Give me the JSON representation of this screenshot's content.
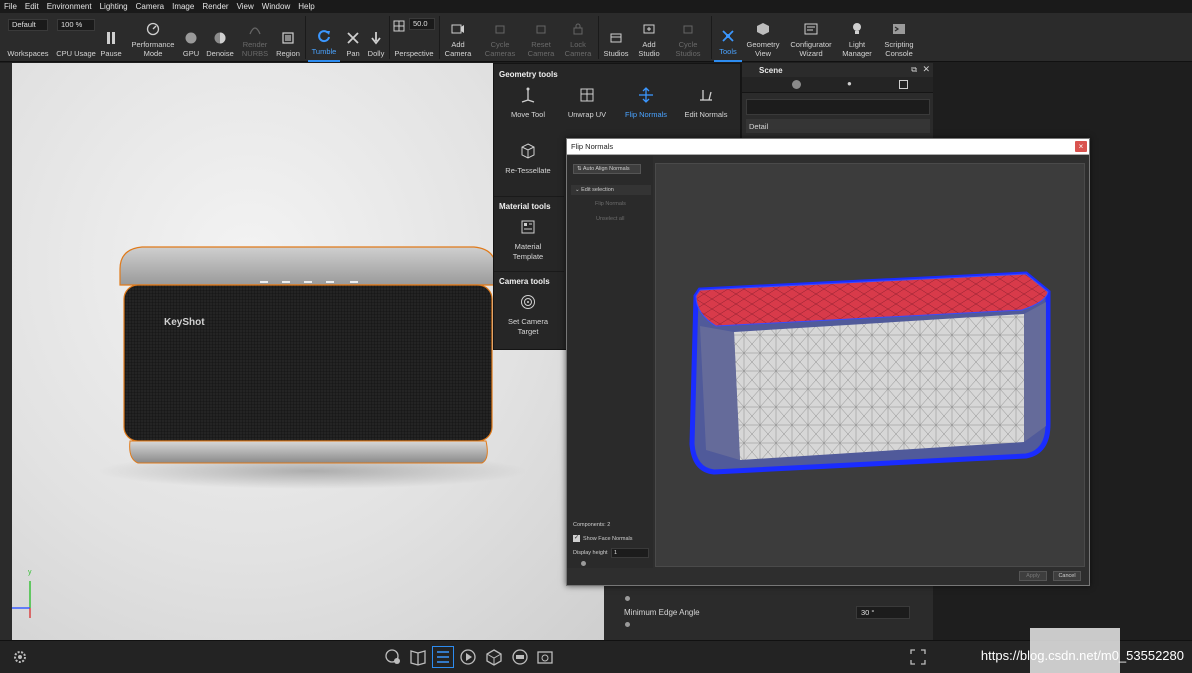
{
  "menu": [
    "File",
    "Edit",
    "Environment",
    "Lighting",
    "Camera",
    "Image",
    "Render",
    "View",
    "Window",
    "Help"
  ],
  "toolbar": {
    "workspace_value": "Default",
    "workspaces_label": "Workspaces",
    "cpu_value": "100 %",
    "cpu_label": "CPU Usage",
    "pause_label": "Pause",
    "performance_label_1": "Performance",
    "performance_label_2": "Mode",
    "gpu_label": "GPU",
    "denoise_label": "Denoise",
    "render_nurbs_1": "Render",
    "render_nurbs_2": "NURBS",
    "region_label": "Region",
    "tumble_label": "Tumble",
    "pan_label": "Pan",
    "dolly_label": "Dolly",
    "fov_value": "50.0",
    "perspective_label": "Perspective",
    "add_camera_1": "Add",
    "add_camera_2": "Camera",
    "cycle_cameras_1": "Cycle",
    "cycle_cameras_2": "Cameras",
    "reset_camera_1": "Reset",
    "reset_camera_2": "Camera",
    "lock_camera_1": "Lock",
    "lock_camera_2": "Camera",
    "studios_label": "Studios",
    "add_studio_1": "Add",
    "add_studio_2": "Studio",
    "cycle_studios_1": "Cycle",
    "cycle_studios_2": "Studios",
    "tools_label": "Tools",
    "geometry_view_1": "Geometry",
    "geometry_view_2": "View",
    "configurator_1": "Configurator",
    "configurator_2": "Wizard",
    "light_manager_1": "Light",
    "light_manager_2": "Manager",
    "scripting_1": "Scripting",
    "scripting_2": "Console"
  },
  "tools_panel": {
    "geometry_heading": "Geometry tools",
    "move_tool": "Move Tool",
    "unwrap_uv": "Unwrap UV",
    "flip_normals": "Flip Normals",
    "edit_normals": "Edit Normals",
    "retessellate": "Re-Tessellate",
    "material_heading": "Material tools",
    "material_template_1": "Material",
    "material_template_2": "Template",
    "camera_heading": "Camera tools",
    "set_camera_target_1": "Set Camera",
    "set_camera_target_2": "Target"
  },
  "scene_panel": {
    "title": "Scene",
    "detail_label": "Detail",
    "min_edge_label": "Minimum Edge Angle",
    "min_edge_value": "30 °"
  },
  "dialog": {
    "title": "Flip Normals",
    "close": "×",
    "auto_align": "Auto Align Normals",
    "edit_selection": "Edit selection",
    "flip_normals": "Flip Normals",
    "unselect_all": "Unselect all",
    "components": "Components: 2",
    "show_face_normals": "Show Face Normals",
    "display_height_label": "Display height",
    "display_height_value": "1",
    "apply": "Apply",
    "cancel": "Cancel"
  },
  "viewport": {
    "logo_text": "KeyShot",
    "axis_y": "y"
  },
  "watermark": "https://blog.csdn.net/m0_53552280",
  "colors": {
    "accent": "#2d8cf0",
    "selection_outline": "#e07a1a",
    "normals_front": "#d7d7d7",
    "normals_flipped": "#d83a4a",
    "edge_highlight": "#1a2cff"
  }
}
